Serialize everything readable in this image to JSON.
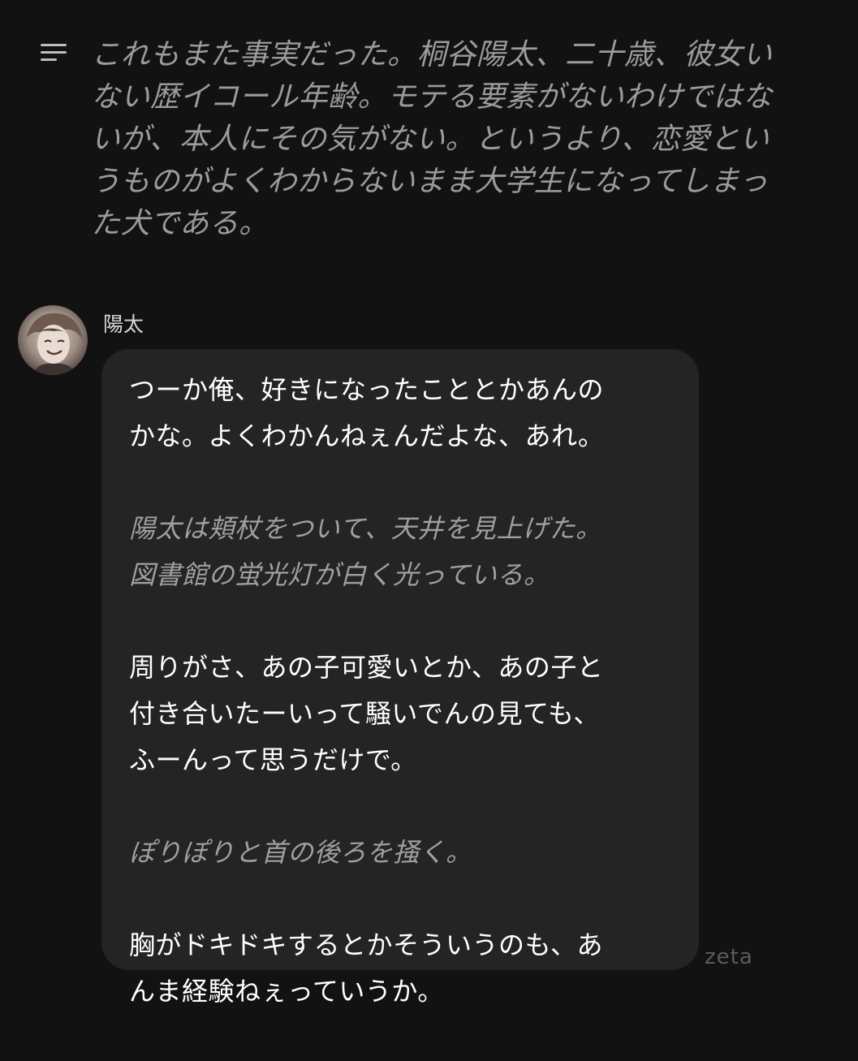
{
  "narration": {
    "lines": [
      "これもまた事実だった。桐谷陽太、二十歳、彼女い",
      "ない歴イコール年齢。モテる要素がないわけではな",
      "いが、本人にその気がない。というより、恋愛とい",
      "うものがよくわからないまま大学生になってしまっ",
      "た犬である。"
    ]
  },
  "message": {
    "sender": "陽太",
    "avatar_icon": "character-avatar",
    "paragraphs": [
      {
        "style": "speech",
        "lines": [
          "つーか俺、好きになったこととかあんの",
          "かな。よくわかんねぇんだよな、あれ。"
        ]
      },
      {
        "style": "action",
        "lines": [
          "陽太は頬杖をついて、天井を見上げた。",
          "図書館の蛍光灯が白く光っている。"
        ]
      },
      {
        "style": "speech",
        "lines": [
          "周りがさ、あの子可愛いとか、あの子と",
          "付き合いたーいって騒いでんの見ても、",
          "ふーんって思うだけで。"
        ]
      },
      {
        "style": "action",
        "lines": [
          "ぽりぽりと首の後ろを掻く。"
        ]
      },
      {
        "style": "speech",
        "lines": [
          "胸がドキドキするとかそういうのも、あ",
          "んま経験ねぇっていうか。"
        ]
      }
    ]
  },
  "watermark": "zeta",
  "colors": {
    "background": "#121212",
    "bubble": "#242424",
    "narration_text": "#9b9b9b",
    "speech_text": "#ffffff",
    "action_text": "#a0a0a0"
  }
}
